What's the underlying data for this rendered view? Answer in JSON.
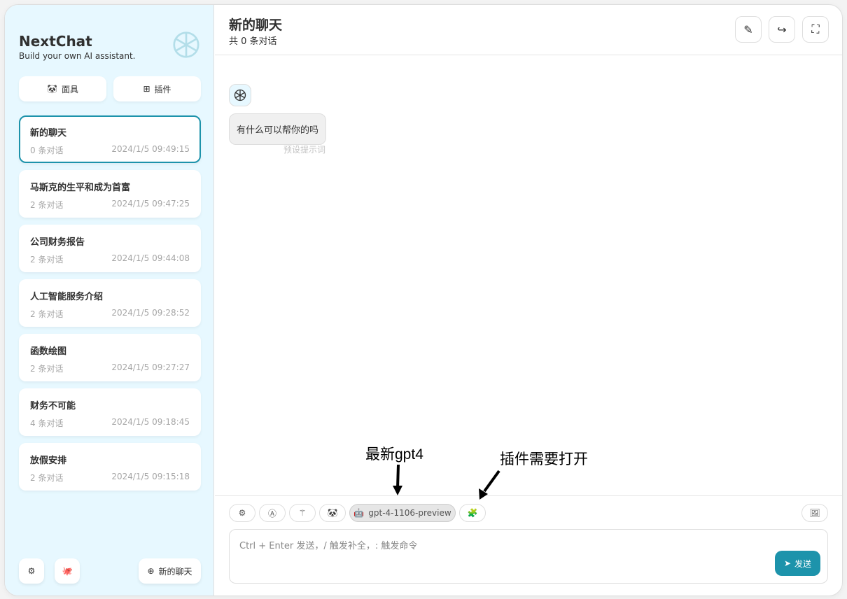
{
  "sidebar": {
    "title": "NextChat",
    "subtitle": "Build your own AI assistant.",
    "mask_label": "面具",
    "plugin_label": "插件",
    "new_chat_label": "新的聊天",
    "chats": [
      {
        "title": "新的聊天",
        "count": "0 条对话",
        "date": "2024/1/5 09:49:15"
      },
      {
        "title": "马斯克的生平和成为首富",
        "count": "2 条对话",
        "date": "2024/1/5 09:47:25"
      },
      {
        "title": "公司财务报告",
        "count": "2 条对话",
        "date": "2024/1/5 09:44:08"
      },
      {
        "title": "人工智能服务介绍",
        "count": "2 条对话",
        "date": "2024/1/5 09:28:52"
      },
      {
        "title": "函数绘图",
        "count": "2 条对话",
        "date": "2024/1/5 09:27:27"
      },
      {
        "title": "财务不可能",
        "count": "4 条对话",
        "date": "2024/1/5 09:18:45"
      },
      {
        "title": "放假安排",
        "count": "2 条对话",
        "date": "2024/1/5 09:15:18"
      }
    ]
  },
  "header": {
    "title": "新的聊天",
    "subtitle": "共 0 条对话"
  },
  "messages": [
    {
      "text": "有什么可以帮你的吗",
      "hint": "预设提示词"
    }
  ],
  "input": {
    "model": "gpt-4-1106-preview",
    "placeholder": "Ctrl + Enter 发送，/ 触发补全，: 触发命令",
    "send_label": "发送"
  },
  "annotations": {
    "model": "最新gpt4",
    "plugin": "插件需要打开"
  },
  "colors": {
    "accent": "#1d93ab",
    "sidebar_bg": "#e7f8ff"
  }
}
